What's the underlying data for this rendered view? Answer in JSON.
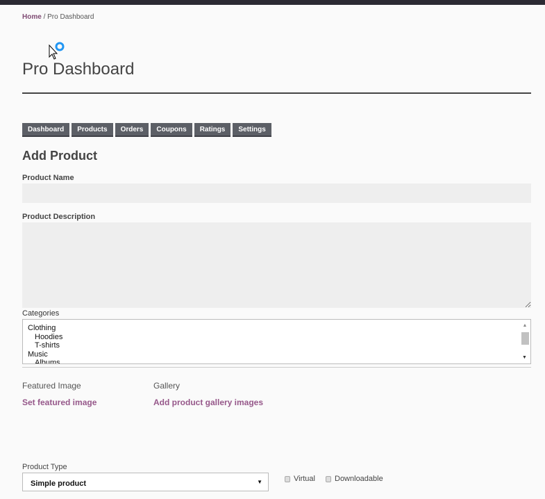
{
  "breadcrumb": {
    "home": "Home",
    "separator": " / ",
    "current": "Pro Dashboard"
  },
  "page_title": "Pro Dashboard",
  "tabs": [
    {
      "label": "Dashboard"
    },
    {
      "label": "Products"
    },
    {
      "label": "Orders"
    },
    {
      "label": "Coupons"
    },
    {
      "label": "Ratings"
    },
    {
      "label": "Settings"
    }
  ],
  "form": {
    "heading": "Add Product",
    "product_name_label": "Product Name",
    "product_name_value": "",
    "description_label": "Product Description",
    "description_value": "",
    "categories_label": "Categories",
    "categories": [
      {
        "label": "Clothing",
        "level": 0
      },
      {
        "label": "Hoodies",
        "level": 1
      },
      {
        "label": "T-shirts",
        "level": 1
      },
      {
        "label": "Music",
        "level": 0
      },
      {
        "label": "Albums",
        "level": 1
      }
    ],
    "featured_image_label": "Featured Image",
    "set_featured_image": "Set featured image",
    "gallery_label": "Gallery",
    "add_gallery": "Add product gallery images",
    "product_type_label": "Product Type",
    "product_type_value": "Simple product",
    "virtual_label": "Virtual",
    "virtual_checked": false,
    "downloadable_label": "Downloadable",
    "downloadable_checked": false
  },
  "colors": {
    "link": "#96588a",
    "tab_bg": "#5c5f66",
    "topbar": "#2b2a33"
  }
}
